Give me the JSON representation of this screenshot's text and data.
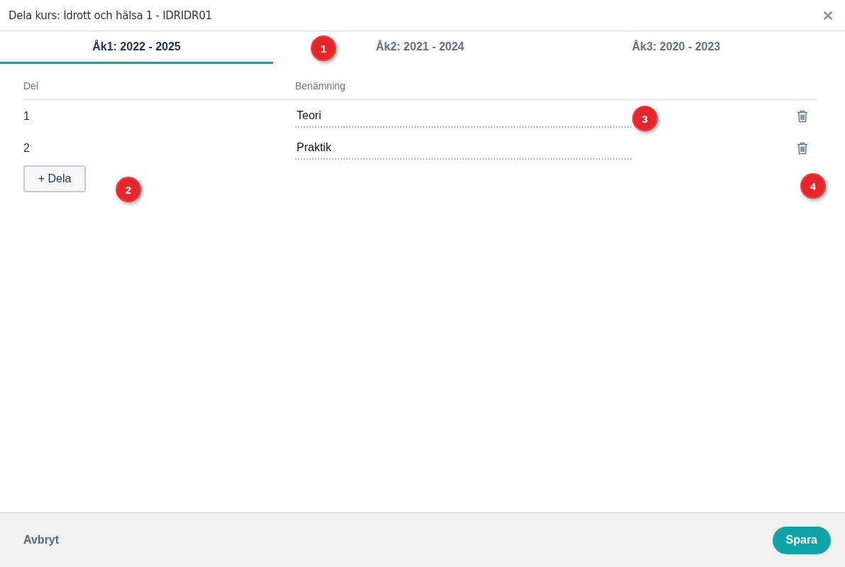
{
  "dialog": {
    "title": "Dela kurs: Idrott och hälsa 1 - IDRIDR01"
  },
  "tabs": [
    {
      "label": "Åk1: 2022 - 2025",
      "selected": true
    },
    {
      "label": "Åk2: 2021 - 2024",
      "selected": false
    },
    {
      "label": "Åk3: 2020 - 2023",
      "selected": false
    }
  ],
  "table": {
    "columns": [
      "Del",
      "Benämning"
    ],
    "rows": [
      {
        "del": "1",
        "name": "Teori"
      },
      {
        "del": "2",
        "name": "Praktik"
      }
    ]
  },
  "add_button": "+ Dela",
  "footer": {
    "cancel": "Avbryt",
    "save": "Spara"
  },
  "annotations": [
    {
      "label": "1"
    },
    {
      "label": "2"
    },
    {
      "label": "3"
    },
    {
      "label": "4"
    }
  ]
}
